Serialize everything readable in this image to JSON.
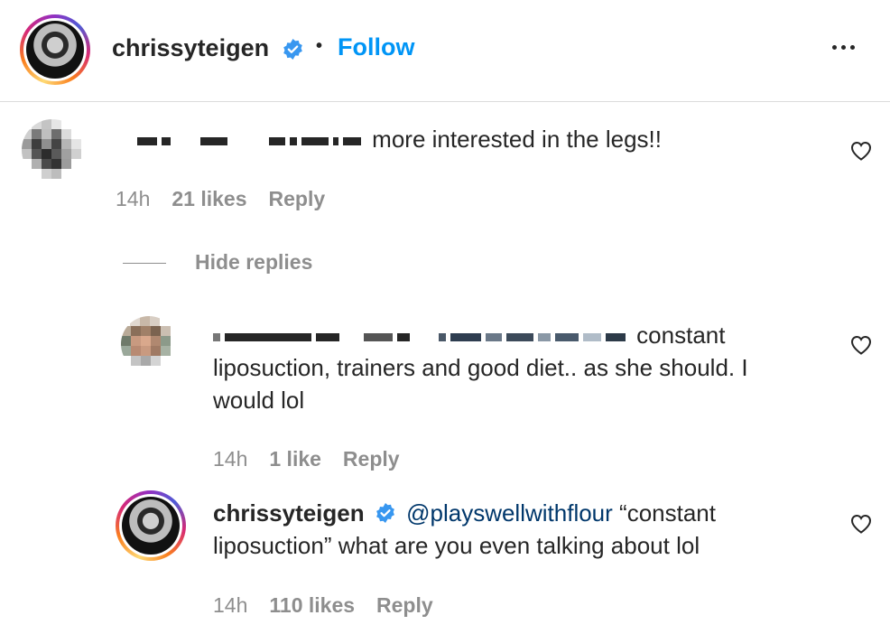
{
  "header": {
    "username": "chrissyteigen",
    "separator": "•",
    "follow_label": "Follow",
    "more_icon": "more-horizontal-icon"
  },
  "comment": {
    "visible_text": "more interested in the legs!!",
    "time": "14h",
    "likes": "21 likes",
    "reply_label": "Reply"
  },
  "hide_replies_label": "Hide replies",
  "replies": [
    {
      "text_line1": "constant",
      "text_line2": "liposuction, trainers and good diet.. as she should. I",
      "text_line3": "would lol",
      "time": "14h",
      "likes": "1 like",
      "reply_label": "Reply"
    },
    {
      "username": "chrissyteigen",
      "mention": "@playswellwithflour",
      "text_line1_rest": "“constant",
      "text_line2": "liposuction” what are you even talking about lol",
      "time": "14h",
      "likes": "110 likes",
      "reply_label": "Reply"
    }
  ],
  "colors": {
    "link_blue": "#0095f6",
    "mention_blue": "#00376b",
    "meta_gray": "#8e8e8e",
    "text": "#262626"
  }
}
